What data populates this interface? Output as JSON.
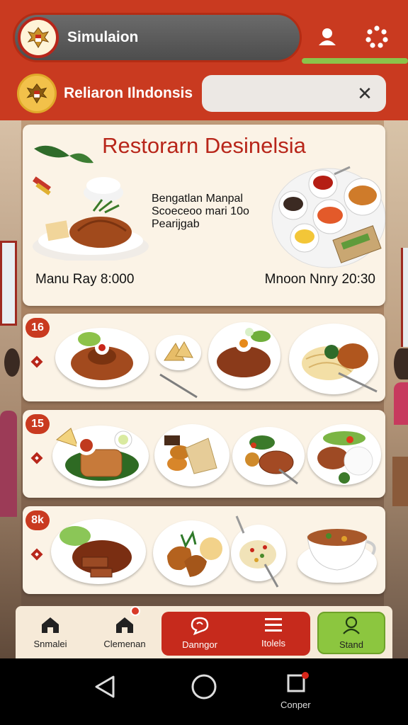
{
  "header": {
    "search_title": "Simulaion",
    "subtitle": "Reliaron Ilndonsis",
    "close_symbol": "✕"
  },
  "hero": {
    "title": "Restorarn Desinelsia",
    "desc_line1": "Bengatlan Manpal",
    "desc_line2": "Scoeceoo mari 10o",
    "desc_line3": "Pearijgab",
    "left_label": "Manu Ray 8:000",
    "right_label": "Mnoon Nnry 20:30"
  },
  "rows": [
    {
      "badge": "16"
    },
    {
      "badge": "15"
    },
    {
      "badge": "8k"
    }
  ],
  "bottom_nav": {
    "items": [
      {
        "label": "Snmalei"
      },
      {
        "label": "Clemenan"
      },
      {
        "label": "Danngor"
      },
      {
        "label": "Itolels"
      },
      {
        "label": "Stand"
      }
    ]
  },
  "system_nav": {
    "recents_label": "Conper"
  },
  "colors": {
    "brand_red": "#c93a20",
    "accent_green": "#8cc63f",
    "panel_cream": "#fbf3e6"
  }
}
